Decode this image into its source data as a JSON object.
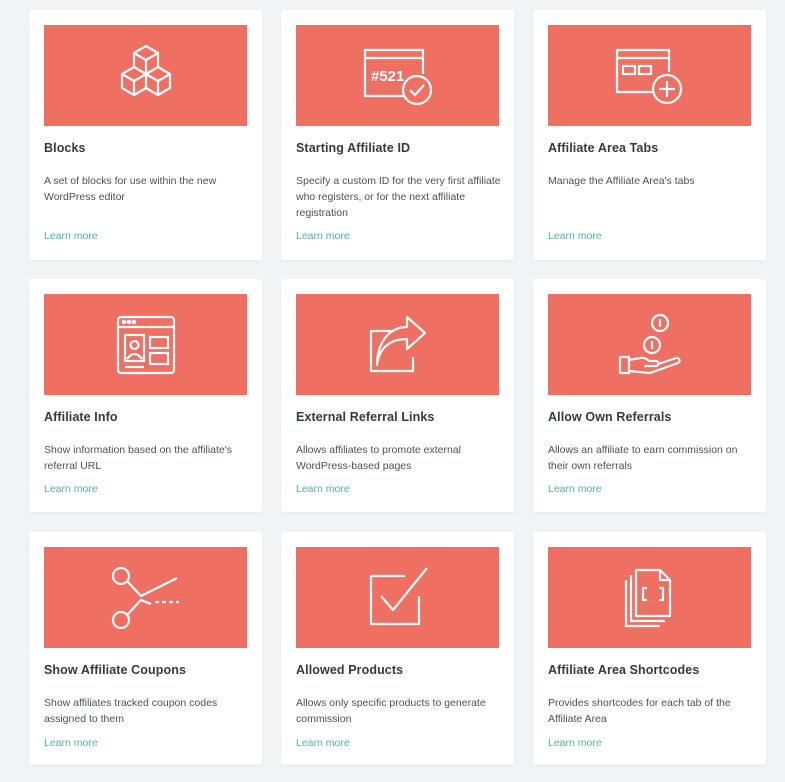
{
  "colors": {
    "page_background": "#f1f3f5",
    "card_background": "#ffffff",
    "banner": "#ef6f62",
    "title_text": "#333a40",
    "body_text": "#4c5156",
    "link": "#4fb0ae"
  },
  "addons": [
    {
      "icon": "cubes-icon",
      "title": "Blocks",
      "description": "A set of blocks for use within the new WordPress editor",
      "link_label": "Learn more"
    },
    {
      "icon": "custom-id-check-icon",
      "icon_text": "#521",
      "title": "Starting Affiliate ID",
      "description": "Specify a custom ID for the very first affiliate who registers, or for the next affiliate registration",
      "link_label": "Learn more"
    },
    {
      "icon": "browser-tabs-add-icon",
      "title": "Affiliate Area Tabs",
      "description": "Manage the Affiliate Area's tabs",
      "link_label": "Learn more"
    },
    {
      "icon": "browser-profile-icon",
      "title": "Affiliate Info",
      "description": "Show information based on the affiliate's referral URL",
      "link_label": "Learn more"
    },
    {
      "icon": "share-arrow-icon",
      "title": "External Referral Links",
      "description": "Allows affiliates to promote external WordPress-based pages",
      "link_label": "Learn more"
    },
    {
      "icon": "hand-coins-icon",
      "title": "Allow Own Referrals",
      "description": "Allows an affiliate to earn commission on their own referrals",
      "link_label": "Learn more"
    },
    {
      "icon": "scissors-coupon-icon",
      "title": "Show Affiliate Coupons",
      "description": "Show affiliates tracked coupon codes assigned to them",
      "link_label": "Learn more"
    },
    {
      "icon": "checkbox-check-icon",
      "title": "Allowed Products",
      "description": "Allows only specific products to generate commission",
      "link_label": "Learn more"
    },
    {
      "icon": "shortcode-documents-icon",
      "title": "Affiliate Area Shortcodes",
      "description": "Provides shortcodes for each tab of the Affiliate Area",
      "link_label": "Learn more"
    }
  ]
}
